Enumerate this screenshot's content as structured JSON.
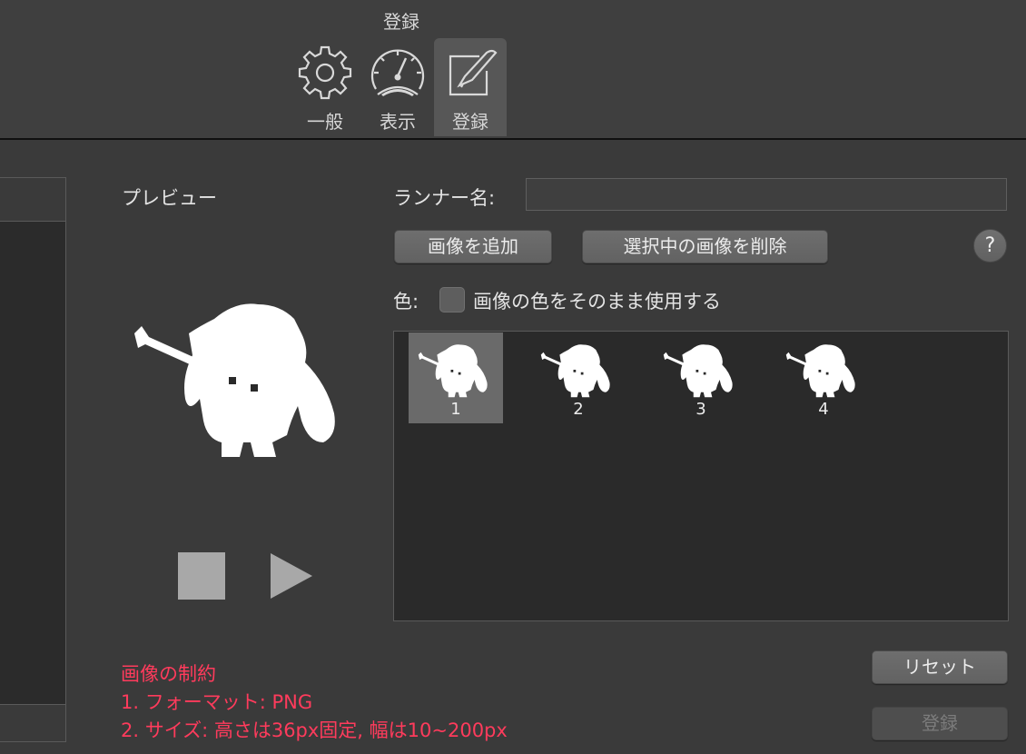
{
  "window": {
    "title": "登録"
  },
  "tabs": [
    {
      "label": "一般",
      "icon": "gear-icon"
    },
    {
      "label": "表示",
      "icon": "gauge-icon"
    },
    {
      "label": "登録",
      "icon": "edit-icon",
      "active": true
    }
  ],
  "preview": {
    "label": "プレビュー"
  },
  "form": {
    "runner_label": "ランナー名:",
    "runner_value": "",
    "add_image_label": "画像を追加",
    "delete_image_label": "選択中の画像を削除",
    "help_label": "?",
    "color_label": "色:",
    "use_image_color_label": "画像の色をそのまま使用する",
    "use_image_color_checked": false
  },
  "images": [
    {
      "number": "1",
      "selected": true
    },
    {
      "number": "2"
    },
    {
      "number": "3"
    },
    {
      "number": "4"
    }
  ],
  "constraints": {
    "title": "画像の制約",
    "line1": "1. フォーマット: PNG",
    "line2": "2. サイズ: 高さは36px固定,  幅は10~200px"
  },
  "buttons": {
    "reset_label": "リセット",
    "register_label": "登録"
  },
  "colors": {
    "background": "#3a3a3a",
    "constraint_text": "#ff3b5c",
    "selected_item": "#6a6a6a"
  }
}
